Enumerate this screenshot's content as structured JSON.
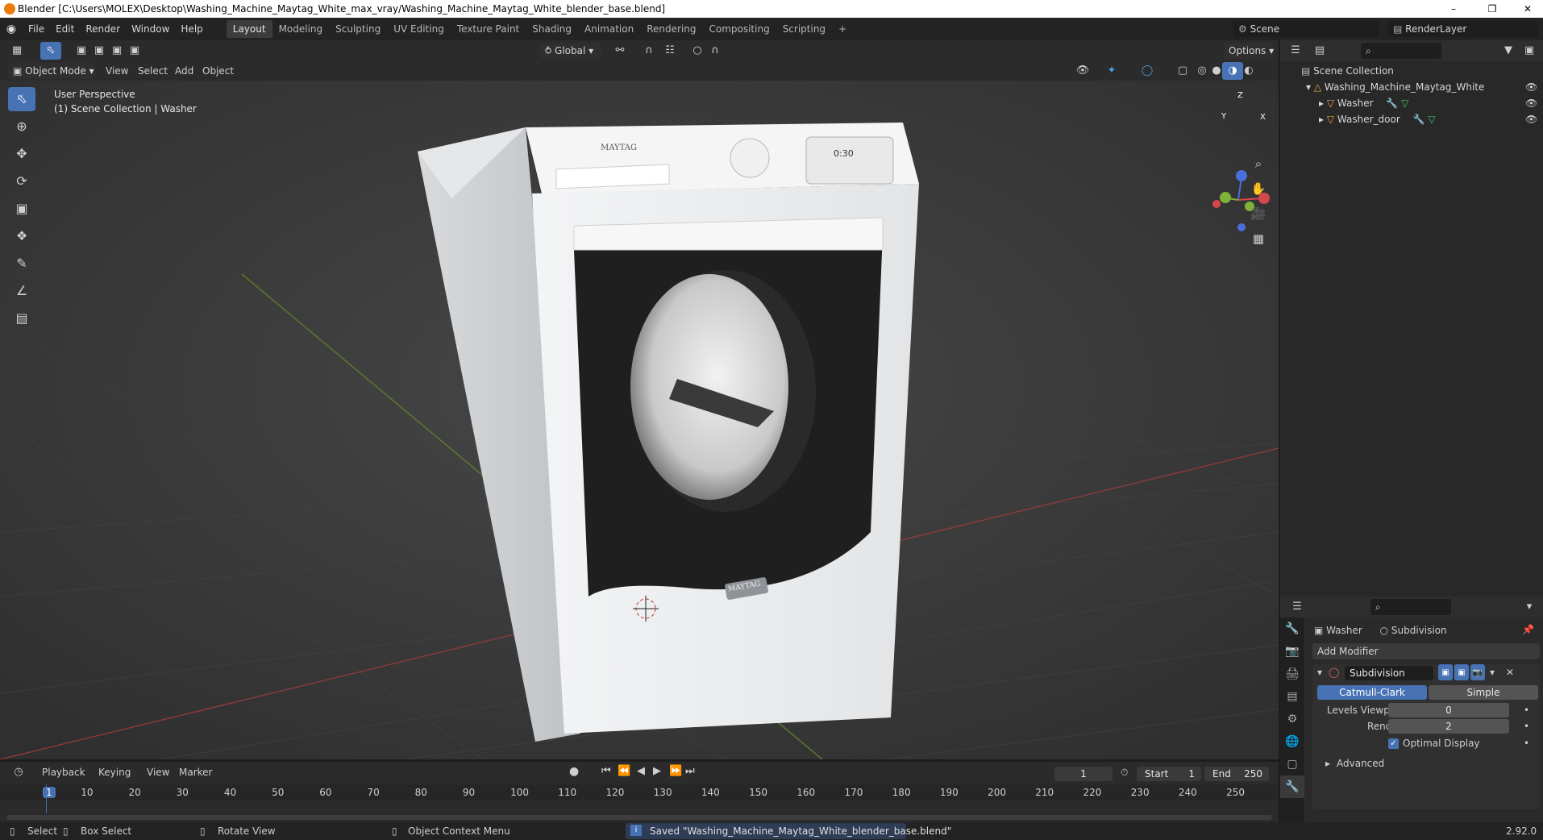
{
  "window": {
    "title": "Blender [C:\\Users\\MOLEX\\Desktop\\Washing_Machine_Maytag_White_max_vray/Washing_Machine_Maytag_White_blender_base.blend]",
    "min_icon": "minimize-icon",
    "max_icon": "maximize-icon",
    "close_icon": "close-icon"
  },
  "menubar": {
    "menus": [
      "File",
      "Edit",
      "Render",
      "Window",
      "Help"
    ],
    "workspaces": [
      "Layout",
      "Modeling",
      "Sculpting",
      "UV Editing",
      "Texture Paint",
      "Shading",
      "Animation",
      "Rendering",
      "Compositing",
      "Scripting"
    ],
    "add_tab": "+",
    "scene_label": "Scene",
    "view_layer_label": "RenderLayer"
  },
  "toolheader": {
    "orientation": "Global",
    "options": "Options"
  },
  "view3d_header": {
    "mode": "Object Mode",
    "menus": [
      "View",
      "Select",
      "Add",
      "Object"
    ]
  },
  "viewport": {
    "info_line1": "User Perspective",
    "info_line2": "(1) Scene Collection | Washer",
    "gizmo": {
      "x": "X",
      "y": "Y",
      "z": "Z"
    },
    "model_brand_top": "MAYTAG",
    "model_brand_door": "MAYTAG",
    "display_time": "0:30"
  },
  "outliner": {
    "root": "Scene Collection",
    "collection": "Washing_Machine_Maytag_White",
    "items": [
      "Washer",
      "Washer_door"
    ]
  },
  "properties": {
    "breadcrumb_object": "Washer",
    "breadcrumb_modifier": "Subdivision",
    "add_modifier": "Add Modifier",
    "modifier_name": "Subdivision",
    "type_catmull": "Catmull-Clark",
    "type_simple": "Simple",
    "levels_viewport_label": "Levels Viewport",
    "levels_viewport_value": "0",
    "render_label": "Render",
    "render_value": "2",
    "optimal_display": "Optimal Display",
    "advanced": "Advanced",
    "accent": "#4772b3"
  },
  "timeline": {
    "menus": [
      "Playback",
      "Keying",
      "View",
      "Marker"
    ],
    "current_frame": "1",
    "start_label": "Start",
    "start_value": "1",
    "end_label": "End",
    "end_value": "250",
    "ruler": [
      "1",
      "10",
      "20",
      "30",
      "40",
      "50",
      "60",
      "70",
      "80",
      "90",
      "100",
      "110",
      "120",
      "130",
      "140",
      "150",
      "160",
      "170",
      "180",
      "190",
      "200",
      "210",
      "220",
      "230",
      "240",
      "250"
    ]
  },
  "status": {
    "select": "Select",
    "box_select": "Box Select",
    "rotate": "Rotate View",
    "context_menu": "Object Context Menu",
    "message": "Saved \"Washing_Machine_Maytag_White_blender_base.blend\"",
    "version": "2.92.0"
  }
}
